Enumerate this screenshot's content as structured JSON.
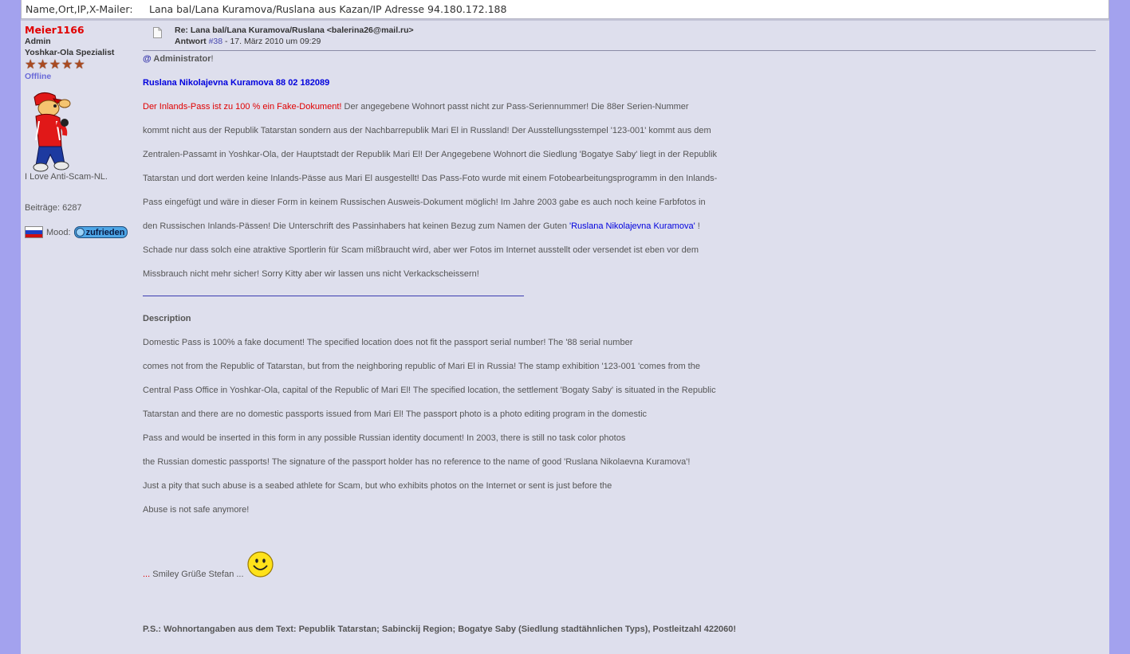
{
  "header": {
    "label": "Name,Ort,IP,X-Mailer:",
    "value": "Lana bal/Lana Kuramova/Ruslana aus Kazan/IP Adresse 94.180.172.188"
  },
  "user": {
    "name": "Meier1166",
    "role": "Admin",
    "rank": "Yoshkar-Ola Spezialist",
    "stars": 5,
    "status": "Offline",
    "slogan": "I Love Anti-Scam-NL.",
    "posts_text": "Beiträge: 6287",
    "mood_label": "Mood:",
    "mood_value": "zufrieden",
    "colors": {
      "name": "#e10000",
      "status": "#6a6ad8",
      "star": "#a94b22"
    }
  },
  "post": {
    "subject": "Re: Lana bal/Lana Kuramova/Ruslana <balerina26@mail.ru>",
    "reply_label": "Antwort",
    "reply_num": "#38",
    "date_text": "- 17. März 2010 um 09:29",
    "admin_at": "@",
    "admin_name": "Administrator",
    "admin_excl": "!",
    "name_line": "Ruslana Nikolajevna Kuramova 88 02 182089",
    "red_lead": "Der Inlands-Pass ist zu 100 % ein Fake-Dokument!",
    "de_line1_rest": " Der angegebene Wohnort passt nicht zur Pass-Seriennummer! Die 88er Serien-Nummer",
    "de_line2": "kommt nicht aus der Republik Tatarstan sondern aus der Nachbarrepublik Mari El in Russland! Der Ausstellungsstempel '123-001' kommt aus dem",
    "de_line3": "Zentralen-Passamt in Yoshkar-Ola, der Hauptstadt der Republik Mari El! Der Angegebene Wohnort die Siedlung 'Bogatye Saby' liegt in der Republik",
    "de_line4": "Tatarstan und dort werden keine Inlands-Pässe aus Mari El ausgestellt! Das Pass-Foto wurde mit einem Fotobearbeitungsprogramm in den Inlands-",
    "de_line5": "Pass eingefügt und wäre in dieser Form in keinem Russischen Ausweis-Dokument möglich! Im Jahre 2003 gabe es auch noch keine Farbfotos in",
    "de_line6_pre": "den Russischen Inlands-Pässen! Die Unterschrift des Passinhabers hat keinen Bezug zum Namen der Guten ",
    "de_line6_name": "'Ruslana Nikolajevna Kuramova'",
    "de_line6_post": " !",
    "de_line7": "Schade nur dass solch eine atraktive Sportlerin für Scam mißbraucht wird, aber wer Fotos im Internet ausstellt oder versendet ist eben vor dem",
    "de_line8": "Missbrauch nicht mehr sicher! Sorry Kitty aber wir lassen uns nicht Verkackscheissern!",
    "desc_title": "Description",
    "en_line1": "Domestic Pass is 100% a fake document! The specified location does not fit the passport serial number! The '88 serial number",
    "en_line2": "comes not from the Republic of Tatarstan, but from the neighboring republic of Mari El in Russia! The stamp exhibition '123-001 'comes from the",
    "en_line3": "Central Pass Office in Yoshkar-Ola, capital of the Republic of Mari El! The specified location, the settlement 'Bogaty Saby' is situated in the Republic",
    "en_line4": "Tatarstan and there are no domestic passports issued from Mari El! The passport photo is a photo editing program in the domestic",
    "en_line5": "Pass and would be inserted in this form in any possible Russian identity document! In 2003, there is still no task color photos",
    "en_line6": "the Russian domestic passports! The signature of the passport holder has no reference to the name of good 'Ruslana Nikolaevna Kuramova'!",
    "en_line7": "Just a pity that such abuse is a seabed athlete for Scam, but who exhibits photos on the Internet or sent is just before the",
    "en_line8": "Abuse is not safe anymore!",
    "sig_dots": "...",
    "sig_text": "  Smiley  Grüße Stefan ...",
    "ps": "P.S.: Wohnortangaben aus dem Text: Pepublik Tatarstan; Sabinckij Region; Bogatye Saby (Siedlung stadtähnlichen Typs), Postleitzahl 422060!"
  }
}
